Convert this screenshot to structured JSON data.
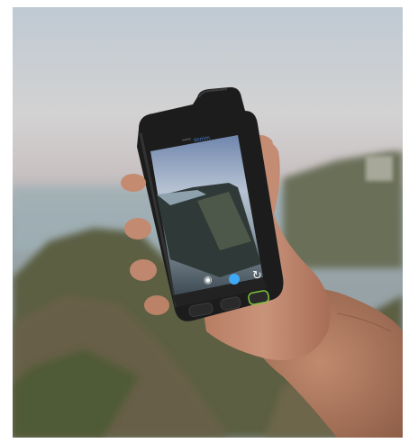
{
  "image": {
    "subject": "hand-holding-rugged-smartphone",
    "colors": {
      "sky": "#c9ced2",
      "phone_body": "#1c1c1c",
      "screen_sky": "#7a8fb0",
      "accent_green": "#7ec43a",
      "shutter_blue": "#3fa9f5"
    }
  },
  "phone": {
    "brand": "sonim",
    "icons": [
      "camera-icon",
      "shutter-button-icon",
      "camera-switch-icon",
      "back-key-icon",
      "home-key-icon",
      "recent-apps-key-icon"
    ]
  }
}
